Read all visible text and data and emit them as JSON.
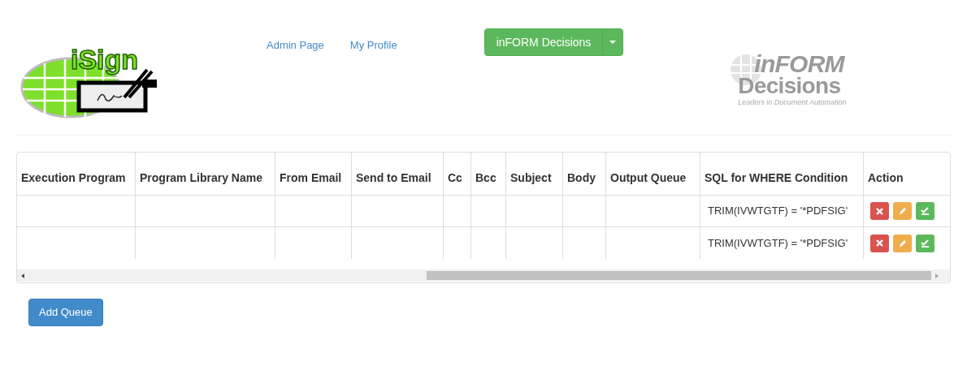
{
  "header": {
    "left_logo": {
      "text": "iSign"
    },
    "nav_links": [
      "Admin Page",
      "My Profile"
    ],
    "split_button": {
      "label": "inFORM Decisions"
    },
    "right_logo": {
      "line_1": "inFORM",
      "line_2": "Decisions",
      "tagline": "Leaders in Document Automation"
    }
  },
  "table": {
    "columns": [
      "Execution Program",
      "Program Library Name",
      "From Email",
      "Send to Email",
      "Cc",
      "Bcc",
      "Subject",
      "Body",
      "Output Queue",
      "SQL for WHERE Condition",
      "Action"
    ],
    "rows": [
      {
        "cells": [
          "",
          "",
          "",
          "",
          "",
          "",
          "",
          "",
          "",
          "TRIM(IVWTGTF) = '*PDFSIG'"
        ],
        "actions": [
          {
            "kind": "delete"
          },
          {
            "kind": "edit"
          },
          {
            "kind": "confirm"
          }
        ]
      },
      {
        "cells": [
          "",
          "",
          "",
          "",
          "",
          "",
          "",
          "",
          "",
          "TRIM(IVWTGTF) = '*PDFSIG'"
        ],
        "actions": [
          {
            "kind": "delete"
          },
          {
            "kind": "edit"
          },
          {
            "kind": "confirm"
          }
        ]
      }
    ]
  },
  "add_button": {
    "label": "Add Queue"
  }
}
